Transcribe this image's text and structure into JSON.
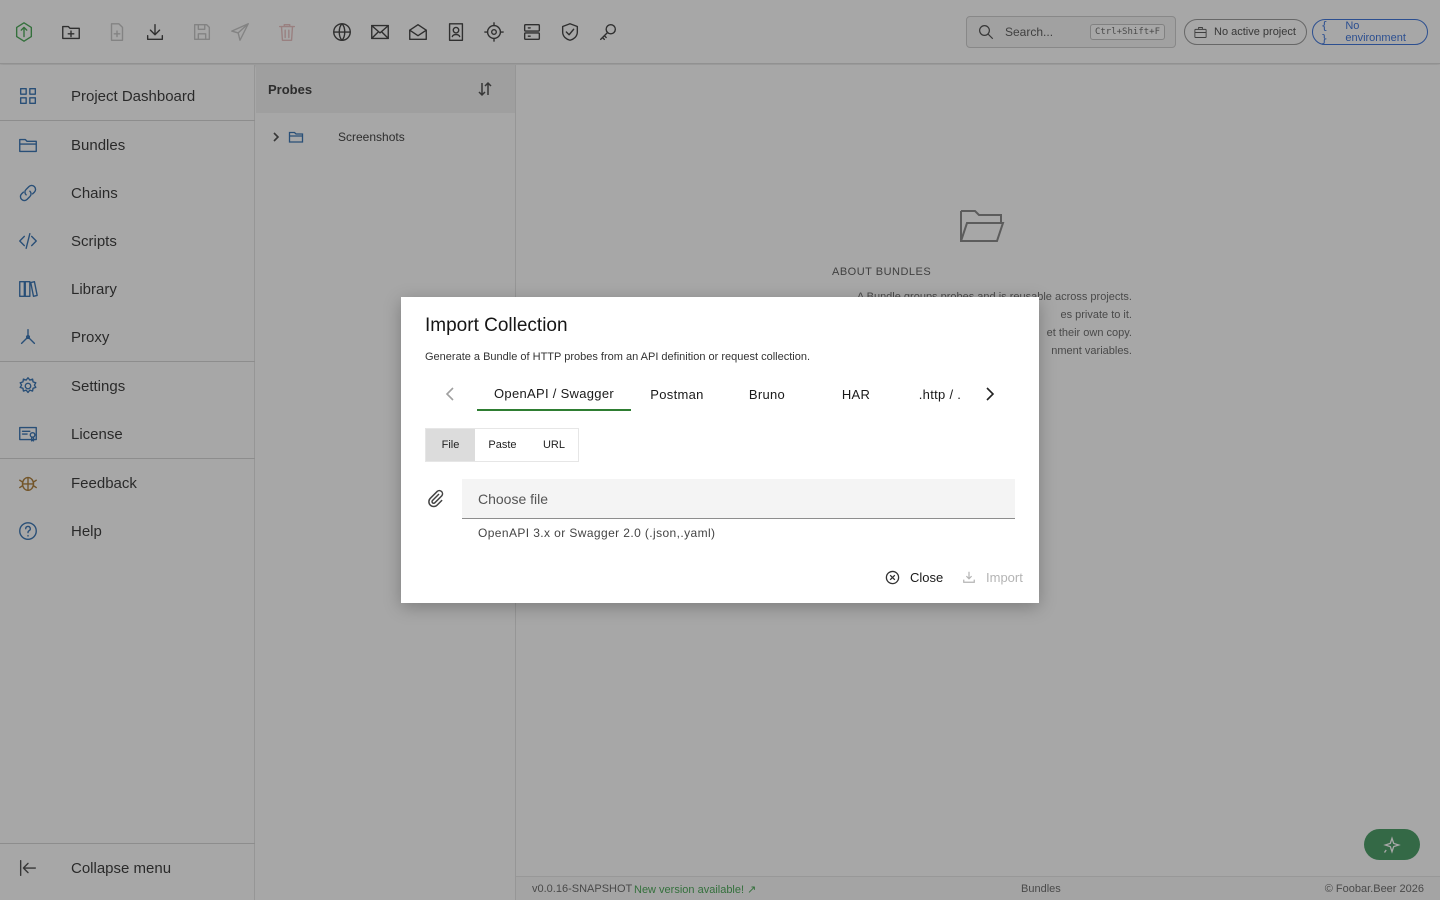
{
  "colors": {
    "accent_green": "#2e7d32",
    "link_blue": "#1f5fd6",
    "update_green": "#2e9b3d"
  },
  "topbar": {
    "icons": [
      "app-logo-icon",
      "new-folder-icon",
      "new-file-icon",
      "download-icon",
      "save-icon",
      "send-icon",
      "delete-icon",
      "globe-icon",
      "mail-icon",
      "mail-open-icon",
      "contact-icon",
      "target-icon",
      "server-icon",
      "shield-check-icon",
      "key-icon"
    ],
    "search_placeholder": "Search...",
    "search_shortcut": "Ctrl+Shift+F",
    "project_label": "No active project",
    "environment_label": "No environment"
  },
  "sidebar": {
    "items": [
      {
        "label": "Project Dashboard",
        "icon": "dashboard-icon"
      },
      {
        "label": "Bundles",
        "icon": "folder-icon"
      },
      {
        "label": "Chains",
        "icon": "link-icon"
      },
      {
        "label": "Scripts",
        "icon": "code-icon"
      },
      {
        "label": "Library",
        "icon": "library-icon"
      },
      {
        "label": "Proxy",
        "icon": "proxy-icon"
      },
      {
        "label": "Settings",
        "icon": "gear-icon"
      },
      {
        "label": "License",
        "icon": "license-icon"
      },
      {
        "label": "Feedback",
        "icon": "bug-icon"
      },
      {
        "label": "Help",
        "icon": "help-icon"
      }
    ],
    "collapse_label": "Collapse menu"
  },
  "probes": {
    "title": "Probes",
    "tree": [
      {
        "label": "Screenshots"
      }
    ]
  },
  "main": {
    "about_title": "ABOUT BUNDLES",
    "about_lines": [
      "A Bundle groups probes and is reusable across projects.",
      "es private to it.",
      "et their own copy.",
      "nment variables."
    ]
  },
  "status": {
    "version": "v0.0.16-SNAPSHOT",
    "update": "New version available! ↗",
    "section": "Bundles",
    "copyright": "© Foobar.Beer 2026"
  },
  "modal": {
    "title": "Import Collection",
    "description": "Generate a Bundle of HTTP probes from an API definition or request collection.",
    "tabs": [
      "OpenAPI / Swagger",
      "Postman",
      "Bruno",
      "HAR",
      ".http / ."
    ],
    "active_tab": "OpenAPI / Swagger",
    "source_modes": [
      "File",
      "Paste",
      "URL"
    ],
    "active_source_mode": "File",
    "file_placeholder": "Choose file",
    "file_helper": "OpenAPI 3.x or Swagger 2.0 (.json,.yaml)",
    "close_label": "Close",
    "import_label": "Import"
  }
}
